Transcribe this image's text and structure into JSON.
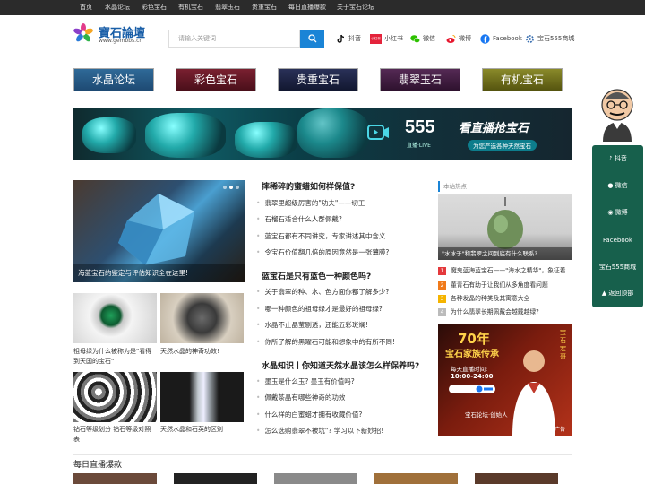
{
  "topnav": [
    "首页",
    "水晶论坛",
    "彩色宝石",
    "有机宝石",
    "翡翠玉石",
    "贵重宝石",
    "每日直播爆款",
    "关于宝石论坛"
  ],
  "logo": {
    "cn": "寶石論壇",
    "en": "www.gembbs.cn"
  },
  "search": {
    "placeholder": "请输入关键词"
  },
  "social": [
    {
      "label": "抖音",
      "icon": "tiktok-icon"
    },
    {
      "label": "小红书",
      "icon": "xiaohongshu-icon",
      "badge": "小红书"
    },
    {
      "label": "微信",
      "icon": "wechat-icon"
    },
    {
      "label": "微博",
      "icon": "weibo-icon"
    },
    {
      "label": "Facebook",
      "icon": "facebook-icon"
    },
    {
      "label": "宝石555商城",
      "icon": "gear-icon"
    }
  ],
  "categories": [
    {
      "label": "水晶论坛",
      "color": "#1e4a73"
    },
    {
      "label": "彩色宝石",
      "color": "#5a1420"
    },
    {
      "label": "贵重宝石",
      "color": "#1a1f3a"
    },
    {
      "label": "翡翠玉石",
      "color": "#3a1a3a"
    },
    {
      "label": "有机宝石",
      "color": "#6b6a1a"
    }
  ],
  "banner": {
    "brand": "555",
    "brand_sub": "直播·LIVE",
    "slogan": "看直播抢宝石",
    "tagline": "为您严选各种天然宝石"
  },
  "feature": {
    "caption": "海蓝宝石的鉴定与评估知识全在这里!"
  },
  "thumbs": [
    {
      "caption": "祖母绿为什么被称为是\"看得到天国的宝石\""
    },
    {
      "caption": "天然水晶的神奇功效!"
    },
    {
      "caption": "钻石等级划分 钻石等级对照表"
    },
    {
      "caption": "天然水晶和石英的区别"
    }
  ],
  "sections": [
    {
      "title": "摔稀碎的蜜蜡如何样保值?",
      "items": [
        "翡翠里超级厉害的\"功夫\"——切工",
        "石榴石适合什么人群佩戴?",
        "蓝宝石都有不同讲究，专家讲述其中含义",
        "令宝石价值翻几倍的原因竟然是一张薄膜?"
      ]
    },
    {
      "title": "蓝宝石是只有蓝色一种颜色吗?",
      "items": [
        "关于翡翠的种、水、色方面你都了解多少?",
        "哪一种颜色的祖母绿才是最好的祖母绿?",
        "水晶不止晶莹剔透，还能五彩斑斓!",
        "你所了解的黑曜石可能和想象中的有所不同!"
      ]
    },
    {
      "title": "水晶知识丨你知道天然水晶该怎么样保养吗?",
      "items": [
        "墨玉是什么玉? 墨玉有价值吗?",
        "佩戴茶晶有哪些神奇的功效",
        "什么样的白蜜蜡才拥有收藏价值?",
        "怎么选购翡翠不被坑\"? 学习以下新妙招!"
      ]
    }
  ],
  "hot": {
    "heading": "本站热点",
    "image_caption": "\"水冰子\"和翡翠之间到底有什么联系?",
    "ranks": [
      {
        "num": "1",
        "text": "魔鬼蓝海蓝宝石——\"海水之精华\"，象征着"
      },
      {
        "num": "2",
        "text": "董青石有助于让我们从多角度看问题"
      },
      {
        "num": "3",
        "text": "各种发晶的种类及其寓意大全"
      },
      {
        "num": "4",
        "text": "为什么翡翠长期佩戴会越戴越绿?"
      }
    ]
  },
  "ad": {
    "years": "70年",
    "headline": "宝石家族传承",
    "hours_label": "每天直播时间:",
    "hours": "10:00-24:00",
    "vertical": "宝石宏哥",
    "footer": "宝石论坛·创始人",
    "tag": "广告"
  },
  "live": {
    "title": "每日直播爆款"
  },
  "float_side": [
    "抖音",
    "微信",
    "微博",
    "Facebook",
    "宝石555商城",
    "返回顶部"
  ]
}
